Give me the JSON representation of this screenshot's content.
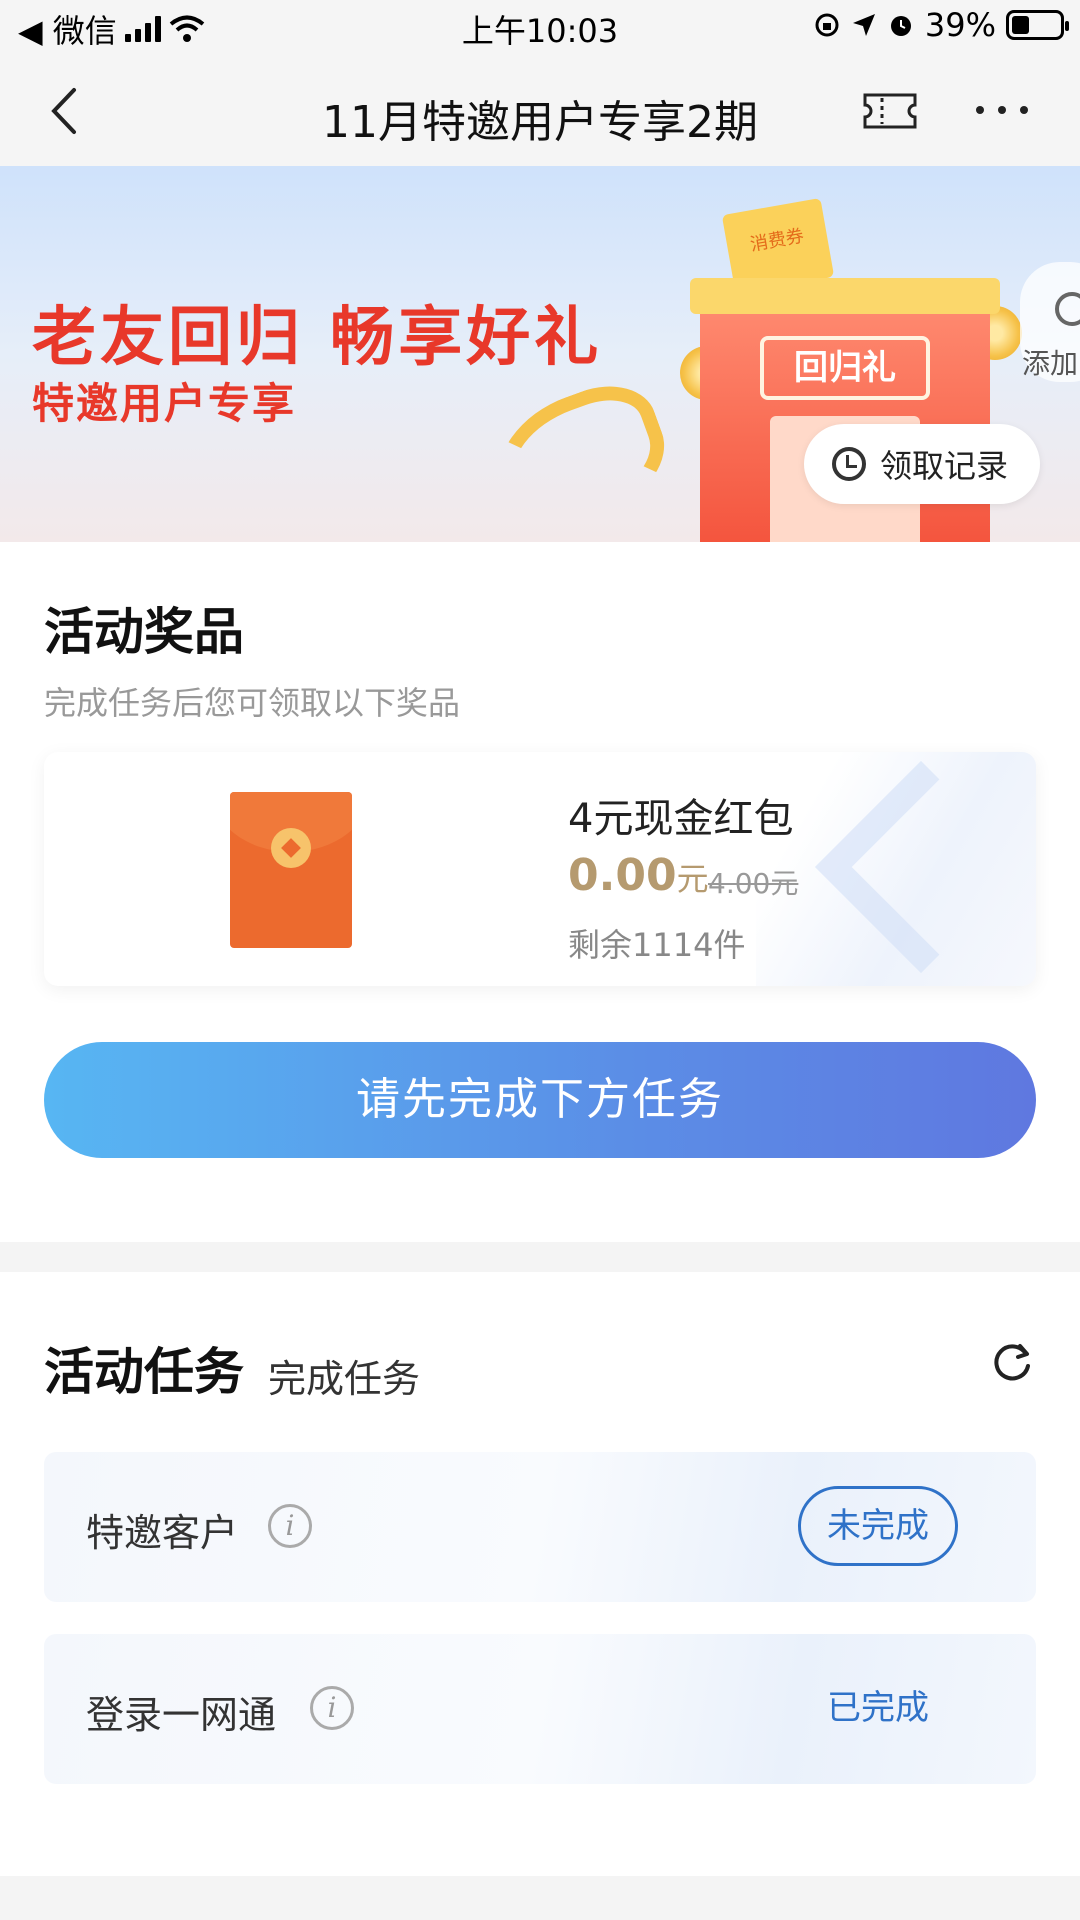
{
  "status_bar": {
    "back_app": "◀ 微信",
    "time": "上午10:03",
    "battery": "39%"
  },
  "nav": {
    "title": "11月特邀用户专享2期"
  },
  "banner": {
    "title": "老友回归 畅享好礼",
    "subtitle": "特邀用户专享",
    "gift_label": "回归礼",
    "coupon_text": "消费券",
    "side_widget_label": "添加",
    "record_button": "领取记录"
  },
  "prizes": {
    "title": "活动奖品",
    "description": "完成任务后您可领取以下奖品",
    "items": [
      {
        "name": "4元现金红包",
        "price": "0.00",
        "price_unit": "元",
        "original_price": "4.00元",
        "stock": "剩余1114件"
      }
    ],
    "cta": "请先完成下方任务"
  },
  "tasks": {
    "title": "活动任务",
    "subtitle": "完成任务",
    "items": [
      {
        "name": "特邀客户",
        "status": "未完成"
      },
      {
        "name": "登录一网通",
        "status": "已完成"
      }
    ]
  },
  "colors": {
    "accent_blue": "#2f72c8",
    "banner_red": "#e8382a",
    "price_gold": "#b59a6f"
  }
}
